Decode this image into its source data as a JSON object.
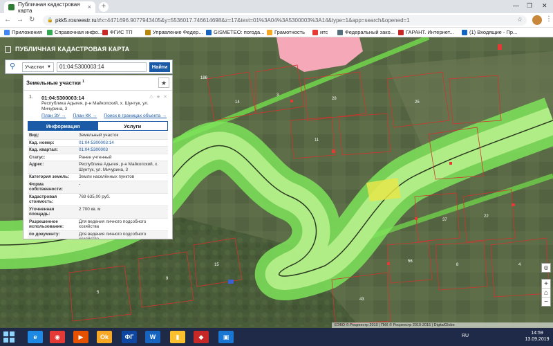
{
  "browser": {
    "tab_title": "Публичная кадастровая карта",
    "tab_close": "×",
    "new_tab": "+",
    "win_min": "—",
    "win_max": "❐",
    "win_close": "✕",
    "url_host": "pkk5.rosreestr.ru",
    "url_path": "/#x=4471696.9077943405&y=5536017.746614698&z=17&text=01%3A04%3A5300003%3A14&type=1&app=search&opened=1",
    "back": "←",
    "forward": "→",
    "reload": "↻",
    "bookmarks": [
      {
        "label": "Приложения",
        "color": "#4285f4"
      },
      {
        "label": "Справочная инфо...",
        "color": "#34a853"
      },
      {
        "label": "ФГИС ТП",
        "color": "#c62828"
      },
      {
        "label": "Управление Федер...",
        "color": "#b8860b"
      },
      {
        "label": "GISMETEO: погода...",
        "color": "#1565c0"
      },
      {
        "label": "Грамотность",
        "color": "#f9a825"
      },
      {
        "label": "итс",
        "color": "#e53935"
      },
      {
        "label": "Федеральный зако...",
        "color": "#546e7a"
      },
      {
        "label": "ГАРАНТ. Интернет...",
        "color": "#c62828"
      },
      {
        "label": "(1) Входящие - Пр...",
        "color": "#1565c0"
      }
    ]
  },
  "portal": {
    "title": "ПУБЛИЧНАЯ КАДАСТРОВАЯ КАРТА",
    "search_type": "Участки",
    "search_value": "01:04:5300003:14",
    "search_button": "Найти"
  },
  "panel": {
    "title": "Земельные участки",
    "count": "1",
    "fav_icon": "★",
    "result_number": "1.",
    "cadastral_number": "01:04:5300003:14",
    "address": "Республика Адыгея, р-н Майкопский, х. Шунтук, ул. Мичурина, 3",
    "action_icons": "⚠ ★ ✕",
    "links": [
      "План ЗУ →",
      "План КК →",
      "Поиск в границах объекта →"
    ],
    "tab_info": "Информация",
    "tab_services": "Услуги",
    "props": [
      {
        "k": "Вид:",
        "v": "Земельный участок",
        "link": false
      },
      {
        "k": "Кад. номер:",
        "v": "01:04:5300003:14",
        "link": true
      },
      {
        "k": "Кад. квартал:",
        "v": "01:04:5300003",
        "link": true
      },
      {
        "k": "Статус:",
        "v": "Ранее учтенный",
        "link": false
      },
      {
        "k": "Адрес:",
        "v": "Республика Адыгея, р-н Майкопский, х. Шунтук, ул. Мичурина, 3",
        "link": false
      },
      {
        "k": "Категория земель:",
        "v": "Земли населённых пунктов",
        "link": false
      },
      {
        "k": "Форма собственности:",
        "v": "-",
        "link": false
      },
      {
        "k": "Кадастровая стоимость:",
        "v": "769 635,00 руб.",
        "link": false
      },
      {
        "k": "Уточненная площадь:",
        "v": "2 700 кв. м",
        "link": false
      },
      {
        "k": "Разрешенное использование:",
        "v": "Для ведения личного подсобного хозяйства",
        "link": false
      },
      {
        "k": "по документу:",
        "v": "Для ведения личного подсобного хозяйства",
        "link": false
      }
    ]
  },
  "map": {
    "attribution": "ЕЭКО © Росреестр 2010 | ПКК © Росреестр 2010-2015 | DigitalGlobe",
    "zoom_in": "+",
    "zoom_out": "−",
    "zoom_other": "⌂",
    "locate": "◎",
    "parcel_labels": [
      "14",
      "3",
      "28",
      "25",
      "186",
      "11",
      "37",
      "22",
      "56",
      "8",
      "4",
      "15",
      "9",
      "43",
      "5"
    ]
  },
  "taskbar": {
    "lang": "RU",
    "time": "14:59",
    "date": "13.09.2019",
    "apps": [
      {
        "label": "e",
        "color": "#1e88e5"
      },
      {
        "label": "◉",
        "color": "#e53935"
      },
      {
        "label": "▶",
        "color": "#e65100"
      },
      {
        "label": "Ok",
        "color": "#f9a825"
      },
      {
        "label": "ФГ",
        "color": "#0d47a1"
      },
      {
        "label": "W",
        "color": "#1565c0"
      },
      {
        "label": "▮",
        "color": "#fbc02d"
      },
      {
        "label": "◆",
        "color": "#c62828"
      },
      {
        "label": "▣",
        "color": "#1976d2"
      }
    ]
  }
}
